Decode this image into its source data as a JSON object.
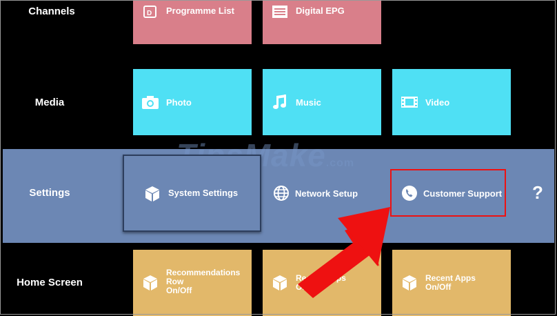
{
  "rows": {
    "channels": "Channels",
    "media": "Media",
    "settings": "Settings",
    "home_screen": "Home Screen"
  },
  "channels_tiles": [
    {
      "label": "Programme List",
      "icon": "programme-list-icon"
    },
    {
      "label": "Digital EPG",
      "icon": "epg-icon"
    }
  ],
  "media_tiles": [
    {
      "label": "Photo",
      "icon": "camera-icon"
    },
    {
      "label": "Music",
      "icon": "music-note-icon"
    },
    {
      "label": "Video",
      "icon": "film-icon"
    }
  ],
  "settings_items": [
    {
      "label": "System Settings",
      "icon": "cube-icon"
    },
    {
      "label": "Network Setup",
      "icon": "globe-icon"
    },
    {
      "label": "Customer Support",
      "icon": "phone-icon"
    }
  ],
  "help_glyph": "?",
  "home_tiles": [
    {
      "line1": "Recommendations",
      "line2": "Row",
      "line3": "On/Off",
      "icon": "cube-icon"
    },
    {
      "line1": "Recent Apps",
      "line2": "On/Off",
      "icon": "cube-icon"
    },
    {
      "line1": "Recent Apps",
      "line2": "On/Off",
      "icon": "cube-icon"
    }
  ],
  "watermark": {
    "main": "TipsMake",
    "suffix": ".com"
  },
  "colors": {
    "channels_tile": "#d97f8a",
    "media_tile": "#4fe0f4",
    "settings_band": "#6c87b4",
    "home_tile": "#e2b86a",
    "highlight": "#ee1111"
  }
}
